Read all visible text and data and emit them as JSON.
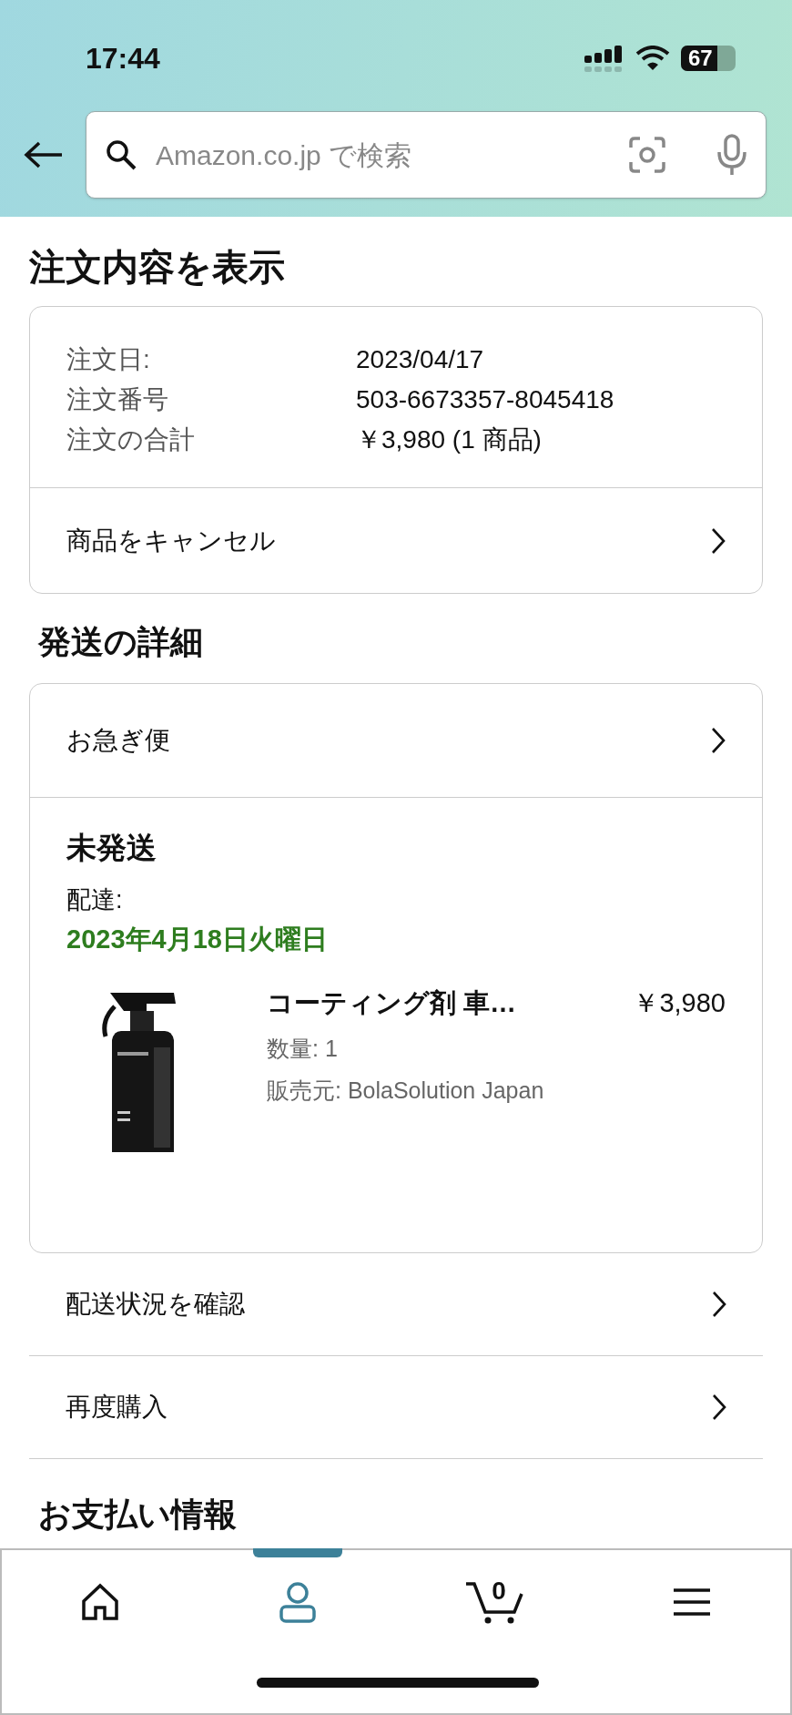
{
  "status_bar": {
    "time": "17:44",
    "battery": "67"
  },
  "search": {
    "placeholder": "Amazon.co.jp で検索"
  },
  "title": "注文内容を表示",
  "order_summary": {
    "rows": [
      {
        "label": "注文日:",
        "value": "2023/04/17"
      },
      {
        "label": "注文番号",
        "value": "503-6673357-8045418"
      },
      {
        "label": "注文の合計",
        "value": "￥3,980 (1 商品)"
      }
    ],
    "action": "商品をキャンセル"
  },
  "shipping": {
    "heading": "発送の詳細",
    "method": "お急ぎ便",
    "status": "未発送",
    "delivery_label": "配達:",
    "delivery_date": "2023年4月18日火曜日",
    "item": {
      "name": "コーティング剤 車…",
      "price": "￥3,980",
      "quantity": "数量: 1",
      "seller": "販売元: BolaSolution Japan"
    }
  },
  "actions": [
    "配送状況を確認",
    "再度購入"
  ],
  "payment_heading": "お支払い情報",
  "nav": {
    "tabs": [
      {
        "kind": "home",
        "selected": false
      },
      {
        "kind": "account",
        "selected": true
      },
      {
        "kind": "cart",
        "selected": false,
        "count": "0"
      },
      {
        "kind": "menu",
        "selected": false
      }
    ]
  }
}
